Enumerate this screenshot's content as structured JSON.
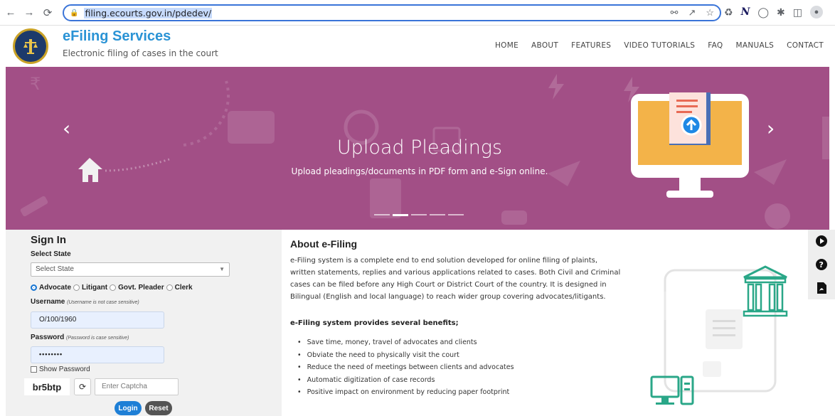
{
  "browser": {
    "url": "filing.ecourts.gov.in/pdedev/"
  },
  "header": {
    "title": "eFiling Services",
    "subtitle": "Electronic filing of cases in the court",
    "nav": [
      "HOME",
      "ABOUT",
      "FEATURES",
      "VIDEO TUTORIALS",
      "FAQ",
      "MANUALS",
      "CONTACT"
    ]
  },
  "hero": {
    "title": "Upload Pleadings",
    "subtitle": "Upload pleadings/documents in PDF form and e-Sign online.",
    "background_color": "#a24f86",
    "slide_count": 5,
    "active_slide": 2
  },
  "signin": {
    "heading": "Sign In",
    "state_label": "Select State",
    "state_selected": "Select State",
    "roles": [
      "Advocate",
      "Litigant",
      "Govt. Pleader",
      "Clerk"
    ],
    "selected_role": "Advocate",
    "username_label": "Username",
    "username_hint": "(Username is not case sensitive)",
    "username_value": "O/100/1960",
    "password_label": "Password",
    "password_hint": "(Password is case sensitive)",
    "password_value": "••••••••",
    "show_password": "Show Password",
    "captcha": "br5btp",
    "captcha_placeholder": "Enter Captcha",
    "login": "Login",
    "reset": "Reset"
  },
  "about": {
    "heading": "About e-Filing",
    "description": "e-Filing system is a complete end to end solution developed for online filing of plaints, written statements, replies and various applications related to cases. Both Civil and Criminal cases can be filed before any High Court or District Court of the country. It is designed in Bilingual (English and local language) to reach wider group covering advocates/litigants.",
    "benefits_heading": "e-Filing system provides several benefits;",
    "benefits": [
      "Save time, money, travel of advocates and clients",
      "Obviate the need to physically visit the court",
      "Reduce the need of meetings between clients and advocates",
      "Automatic digitization of case records",
      "Positive impact on environment by reducing paper footprint"
    ]
  },
  "side_bar": {
    "icons": [
      "play-icon",
      "help-icon",
      "pdf-icon"
    ]
  },
  "colors": {
    "brand_blue": "#2a93d5",
    "hero": "#a24f86",
    "login_button": "#1e7fd6",
    "reset_button": "#545454"
  }
}
